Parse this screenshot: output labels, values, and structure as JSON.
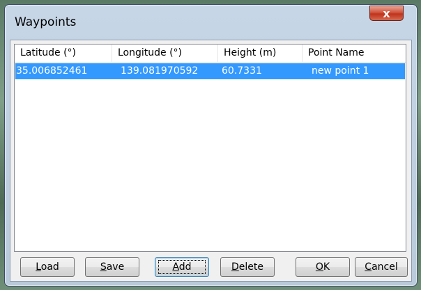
{
  "window": {
    "title": "Waypoints",
    "close_label": "x"
  },
  "list": {
    "columns": [
      "Latitude (°)",
      "Longitude (°)",
      "Height (m)",
      "Point Name"
    ],
    "rows": [
      [
        "35.006852461",
        "139.081970592",
        "60.7331",
        "new point 1"
      ]
    ]
  },
  "buttons": {
    "load": {
      "accel": "L",
      "rest": "oad"
    },
    "save": {
      "accel": "S",
      "rest": "ave"
    },
    "add": {
      "accel": "A",
      "rest": "dd"
    },
    "delete": {
      "accel": "D",
      "rest": "elete"
    },
    "ok": {
      "accel": "O",
      "rest": "K"
    },
    "cancel": {
      "accel": "C",
      "rest": "ancel"
    }
  },
  "colors": {
    "selection": "#3399ff",
    "close_button": "#c7432a"
  }
}
